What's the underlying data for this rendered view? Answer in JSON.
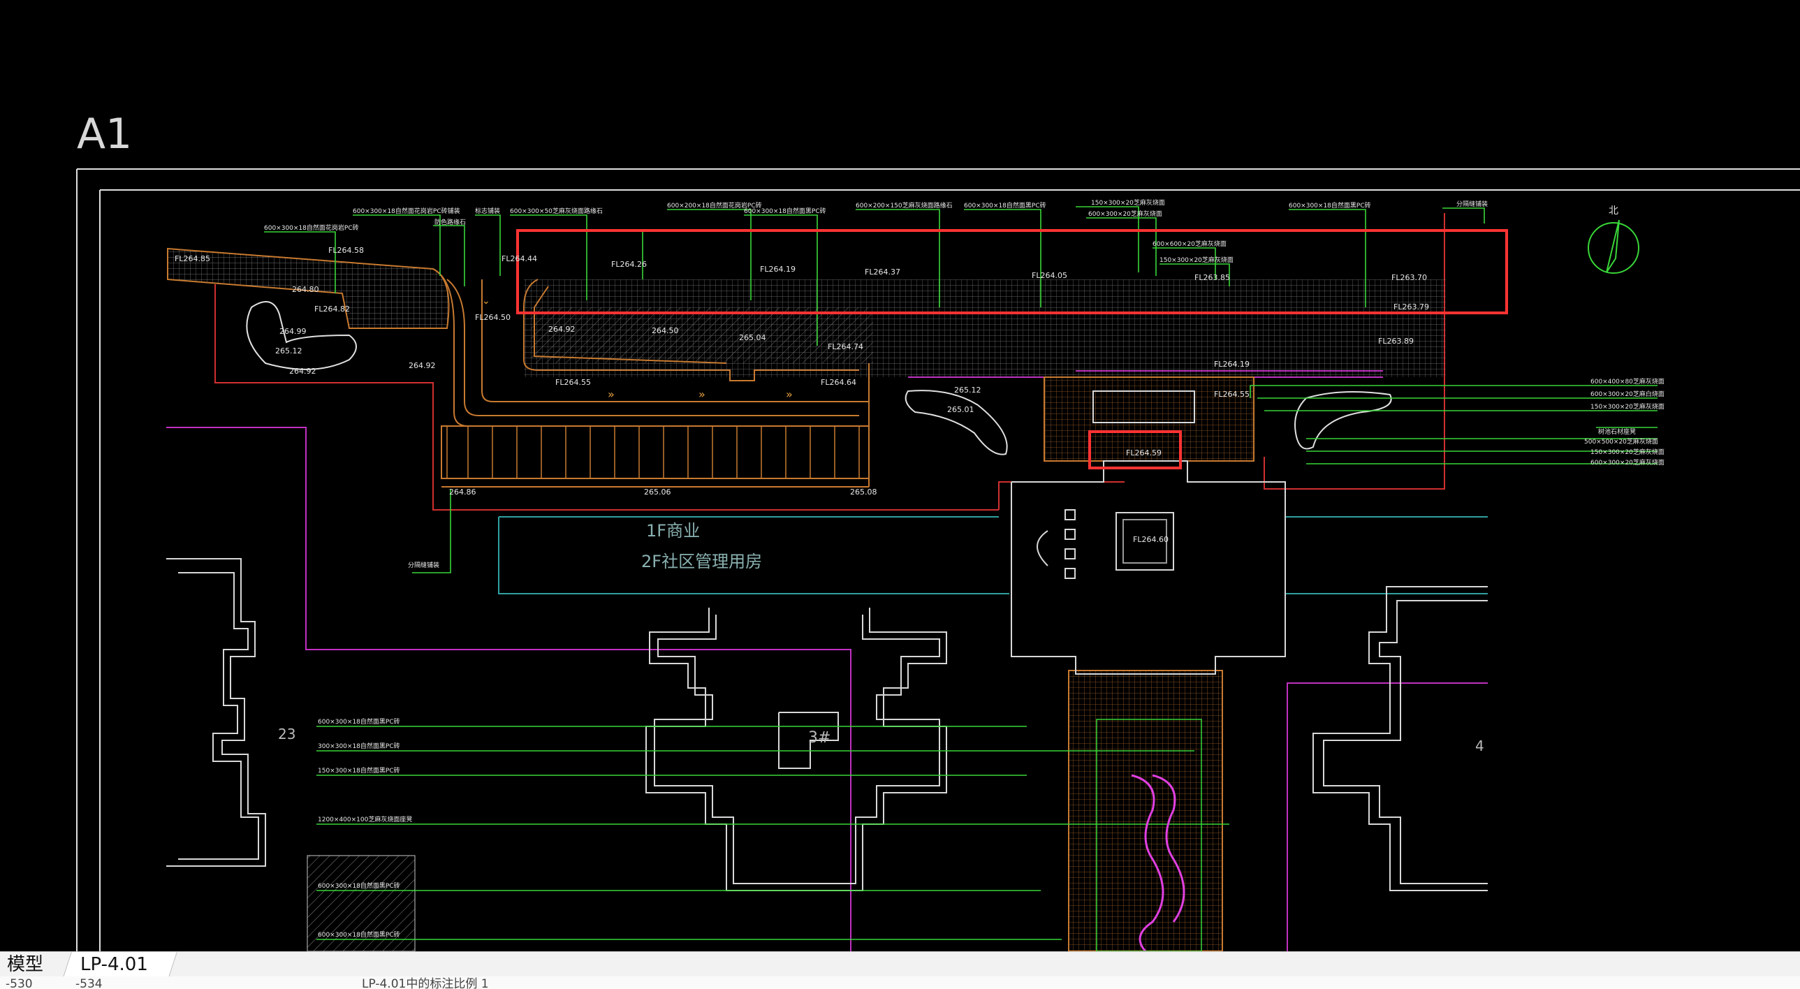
{
  "sheet_title": "A1",
  "tabs": {
    "model": "模型",
    "layout": "LP-4.01"
  },
  "status": {
    "coord_x": "-530",
    "coord_y": "-534",
    "message": "LP-4.01中的标注比例 1"
  },
  "buildings": {
    "label_1f": "1F商业",
    "label_2f": "2F社区管理用房",
    "num_3": "3#",
    "num_23": "23",
    "num_4": "4"
  },
  "north_arrow": {
    "label": "北"
  },
  "elevations": {
    "fl26485": "FL264.85",
    "fl26458": "FL264.58",
    "fl26482": "FL264.82",
    "fl26444": "FL264.44",
    "fl26450": "FL264.50",
    "fl26426": "FL264.26",
    "fl26419": "FL264.19",
    "fl26437": "FL264.37",
    "fl26405": "FL264.05",
    "fl26385": "FL263.85",
    "fl26370": "FL263.70",
    "fl26379": "FL263.79",
    "fl26389": "FL263.89",
    "fl26419b": "FL264.19",
    "fl26455": "FL264.55",
    "fl26464": "FL264.64",
    "fl26474": "FL264.74",
    "fl26455b": "FL264.55",
    "fl26460": "FL264.60",
    "fl26459": "FL264.59",
    "e26480": "264.80",
    "e26499": "264.99",
    "e26512": "265.12",
    "e26492a": "264.92",
    "e26492b": "264.92",
    "e26492c": "264.92",
    "e26450": "264.50",
    "e26504": "265.04",
    "e26486": "264.86",
    "e26506": "265.06",
    "e26508": "265.08",
    "e26512b": "265.12",
    "e26501": "265.01"
  },
  "annotations": {
    "a1": "600×300×18自然面花岗岩PC砖",
    "a2": "600×300×18自然面花岗岩PC砖铺装",
    "a3": "防色路缘石",
    "a4": "标志铺装",
    "a5": "600×300×50芝麻灰烧面路缘石",
    "a6": "600×200×18自然面花岗岩PC砖",
    "a7": "600×300×18自然面黑PC砖",
    "a8": "600×200×150芝麻灰烧面路缘石",
    "a9": "600×300×18自然面黑PC砖",
    "a10": "150×300×20芝麻灰烧面",
    "a11": "600×300×20芝麻灰烧面",
    "a12": "600×300×18自然面黑PC砖",
    "a13": "分隔缝铺装",
    "a14": "600×600×20芝麻灰烧面",
    "a15": "150×300×20芝麻灰烧面",
    "r1": "600×400×80芝麻灰烧面",
    "r2": "600×300×20芝麻白烧面",
    "r3": "150×300×20芝麻灰烧面",
    "r4": "树池石材座凳",
    "r5": "500×500×20芝麻灰烧面",
    "r6": "150×300×20芝麻灰烧面",
    "r7": "600×300×20芝麻灰烧面",
    "l1": "600×300×18自然面黑PC砖",
    "l2": "300×300×18自然面黑PC砖",
    "l3": "150×300×18自然面黑PC砖",
    "l4": "1200×400×100芝麻灰烧面座凳",
    "l5": "600×300×18自然面黑PC砖",
    "l6": "600×300×18自然面黑PC砖",
    "m1": "分隔缝铺装"
  },
  "colors": {
    "highlight": "#ff3333",
    "paving": "#c87a30",
    "boundary": "#e0e0e0",
    "leader": "#39d639",
    "purple": "#c030c0",
    "cyan": "#30a0a0",
    "building": "#d8d8d8"
  }
}
